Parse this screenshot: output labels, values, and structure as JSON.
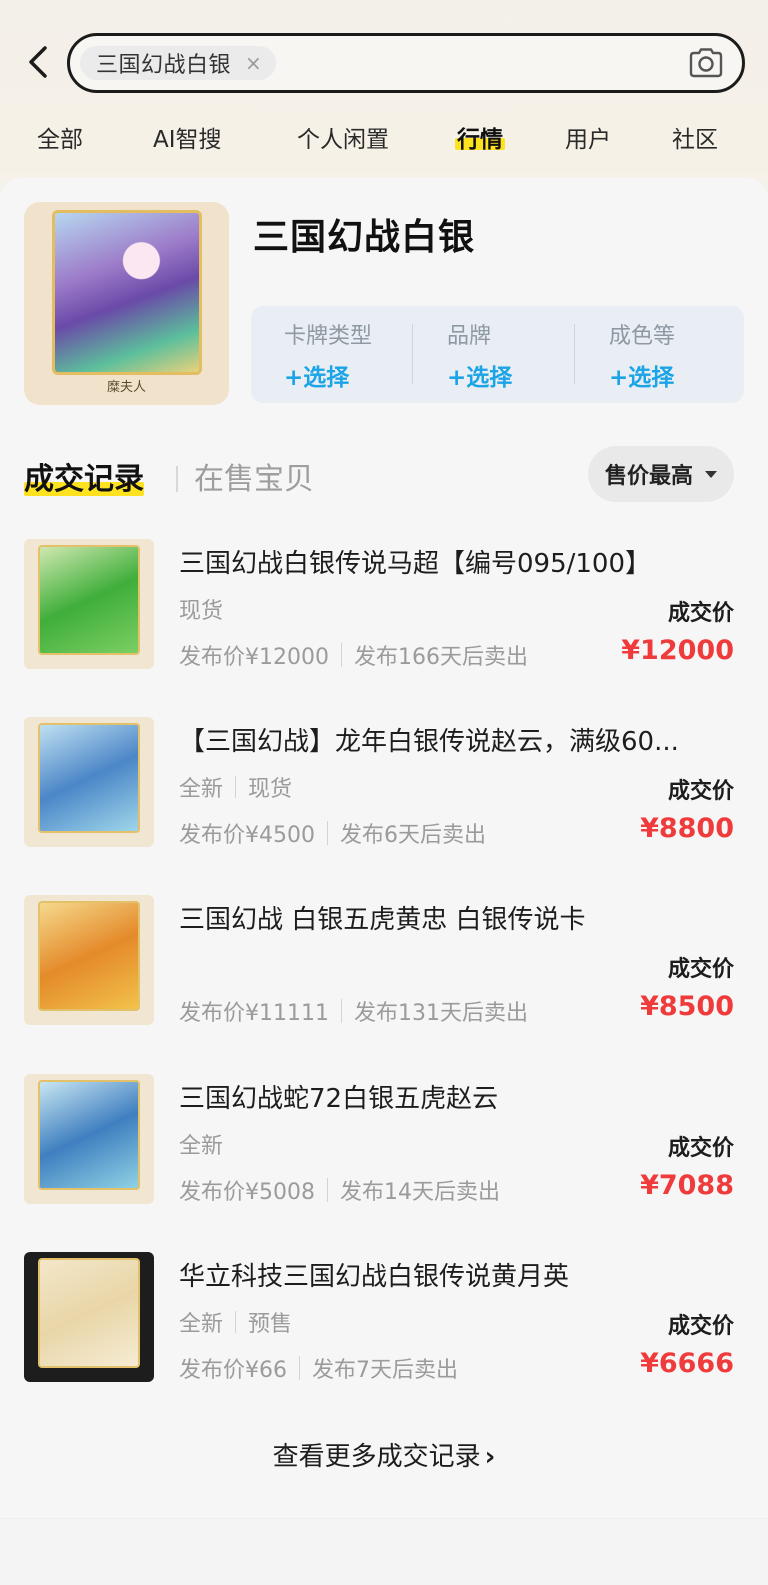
{
  "search": {
    "chip_text": "三国幻战白银",
    "chip_close": "×"
  },
  "tabs": [
    {
      "label": "全部",
      "active": false
    },
    {
      "label": "AI智搜",
      "active": false
    },
    {
      "label": "个人闲置",
      "active": false
    },
    {
      "label": "行情",
      "active": true
    },
    {
      "label": "用户",
      "active": false
    },
    {
      "label": "社区",
      "active": false
    }
  ],
  "product": {
    "title": "三国幻战白银",
    "thumb_card_name": "糜夫人",
    "attributes": [
      {
        "label": "卡牌类型",
        "action": "+选择"
      },
      {
        "label": "品牌",
        "action": "+选择"
      },
      {
        "label": "成色等",
        "action": "+选择"
      }
    ]
  },
  "section": {
    "active_tab": "成交记录",
    "inactive_tab": "在售宝贝",
    "sort_label": "售价最高"
  },
  "records": [
    {
      "title": "三国幻战白银传说马超【编号095/100】",
      "tags": [
        "现货"
      ],
      "publish_price": "发布价¥12000",
      "sold_after": "发布166天后卖出",
      "price_label": "成交价",
      "price": "¥12000",
      "art_colors": [
        "#cfe8b0",
        "#3fae3a",
        "#7ccf62"
      ]
    },
    {
      "title": "【三国幻战】龙年白银传说赵云，满级60...",
      "tags": [
        "全新",
        "现货"
      ],
      "publish_price": "发布价¥4500",
      "sold_after": "发布6天后卖出",
      "price_label": "成交价",
      "price": "¥8800",
      "art_colors": [
        "#bfe0f2",
        "#4b86c7",
        "#9fd6ea"
      ]
    },
    {
      "title": "三国幻战 白银五虎黄忠 白银传说卡",
      "tags": [],
      "publish_price": "发布价¥11111",
      "sold_after": "发布131天后卖出",
      "price_label": "成交价",
      "price": "¥8500",
      "art_colors": [
        "#f5d98c",
        "#e48a2a",
        "#f2c24a"
      ]
    },
    {
      "title": "三国幻战蛇72白银五虎赵云",
      "tags": [
        "全新"
      ],
      "publish_price": "发布价¥5008",
      "sold_after": "发布14天后卖出",
      "price_label": "成交价",
      "price": "¥7088",
      "art_colors": [
        "#c8e6f2",
        "#3f7fc0",
        "#8fd2e4"
      ]
    },
    {
      "title": "华立科技三国幻战白银传说黄月英",
      "tags": [
        "全新",
        "预售"
      ],
      "publish_price": "发布价¥66",
      "sold_after": "发布7天后卖出",
      "price_label": "成交价",
      "price": "¥6666",
      "art_colors": [
        "#f3e6c9",
        "#e9d6a8",
        "#f6ecd4"
      ]
    }
  ],
  "more_link": "查看更多成交记录"
}
